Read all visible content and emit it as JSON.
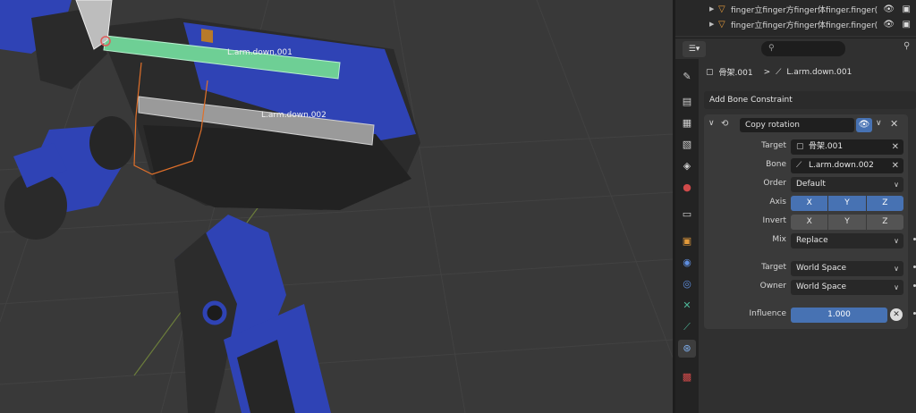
{
  "viewport": {
    "bone_labels": [
      "L.arm.down.001",
      "L.arm.down.002"
    ]
  },
  "outliner": {
    "rows": [
      {
        "label": "finger立finger方finger体finger.finger("
      },
      {
        "label": "finger立finger方finger体finger.finger("
      }
    ]
  },
  "properties": {
    "editor_icon": "properties-editor-icon",
    "search_placeholder": "",
    "breadcrumb": {
      "armature": "骨架.001",
      "separator": ">",
      "bone": "L.arm.down.001"
    },
    "add_constraint_label": "Add Bone Constraint",
    "constraint": {
      "name": "Copy rotation",
      "target_label": "Target",
      "target_value": "骨架.001",
      "bone_label": "Bone",
      "bone_value": "L.arm.down.002",
      "order_label": "Order",
      "order_value": "Default",
      "axis_label": "Axis",
      "axis": [
        {
          "name": "X",
          "on": true
        },
        {
          "name": "Y",
          "on": true
        },
        {
          "name": "Z",
          "on": true
        }
      ],
      "invert_label": "Invert",
      "invert": [
        {
          "name": "X",
          "on": false
        },
        {
          "name": "Y",
          "on": false
        },
        {
          "name": "Z",
          "on": false
        }
      ],
      "mix_label": "Mix",
      "mix_value": "Replace",
      "target_space_label": "Target",
      "target_space_value": "World Space",
      "owner_space_label": "Owner",
      "owner_space_value": "World Space",
      "influence_label": "Influence",
      "influence_value": "1.000"
    }
  },
  "colors": {
    "accent": "#4772b3",
    "selected_bone": "#6ecf95",
    "object_orange": "#e39a3b"
  }
}
